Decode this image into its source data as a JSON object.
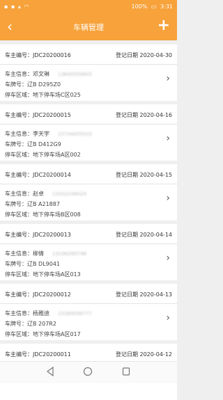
{
  "status_bar": {
    "left_icons": "▪ ▪ ▴ ◠",
    "battery": "100%",
    "time": "3:31"
  },
  "nav": {
    "back_icon": "‹",
    "title": "车辆管理",
    "add_icon": "+"
  },
  "labels": {
    "code_prefix": "车主编号：",
    "date_prefix": "登记日期 ",
    "owner_prefix": "车主信息：",
    "plate_prefix": "车牌号：",
    "area_prefix": "停车区域："
  },
  "cards": [
    {
      "code": "JDC20200016",
      "date": "2020-04-30",
      "owner": "邓文琳",
      "phone": "13645559805",
      "plate": "辽B D295Z0",
      "area": "地下停车场C区025"
    },
    {
      "code": "JDC20200015",
      "date": "2020-04-16",
      "owner": "李天宇",
      "phone": "15734455010",
      "plate": "辽B D412G9",
      "area": "地下停车场A区002"
    },
    {
      "code": "JDC20200014",
      "date": "2020-04-15",
      "owner": "赵卓",
      "phone": "13332248024",
      "plate": "辽B A21887",
      "area": "地下停车场B区008"
    },
    {
      "code": "JDC20200013",
      "date": "2020-04-14",
      "owner": "柳倩",
      "phone": "13196289748",
      "plate": "辽B DL9041",
      "area": "地下停车场A区013"
    },
    {
      "code": "JDC20200012",
      "date": "2020-04-13",
      "owner": "杨雅迪",
      "phone": "15389599777",
      "plate": "辽B 207R2",
      "area": "地下停车场A区017"
    },
    {
      "code": "JDC20200011",
      "date": "2020-04-12",
      "owner": "",
      "phone": "",
      "plate": "",
      "area": ""
    }
  ],
  "bottom_nav": {
    "back": "◁",
    "home": "○",
    "recent": "□"
  }
}
